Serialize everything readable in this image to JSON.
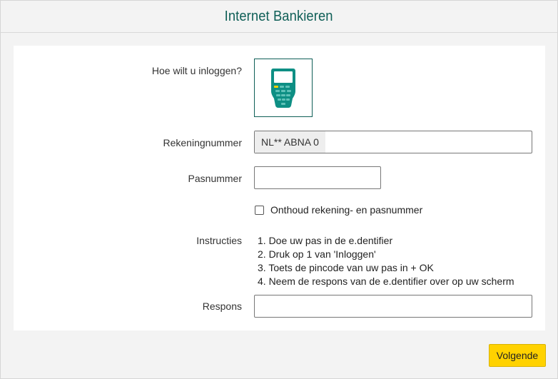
{
  "header": {
    "title": "Internet Bankieren"
  },
  "form": {
    "login_method_label": "Hoe wilt u inloggen?",
    "login_method_icon": "edentifier-icon",
    "account_label": "Rekeningnummer",
    "account_prefix": "NL** ABNA 0",
    "account_value": "",
    "card_label": "Pasnummer",
    "card_value": "",
    "remember_label": "Onthoud rekening- en pasnummer",
    "remember_checked": false,
    "instructions_label": "Instructies",
    "instructions": [
      "1. Doe uw pas in de e.dentifier",
      "2. Druk op 1 van 'Inloggen'",
      "3. Toets de pincode van uw pas in + OK",
      "4. Neem de respons van de e.dentifier over op uw scherm"
    ],
    "response_label": "Respons",
    "response_value": ""
  },
  "footer": {
    "next_label": "Volgende"
  },
  "colors": {
    "brand_green": "#0f5f57",
    "device_teal": "#0e8f84",
    "button_yellow": "#ffd200"
  }
}
